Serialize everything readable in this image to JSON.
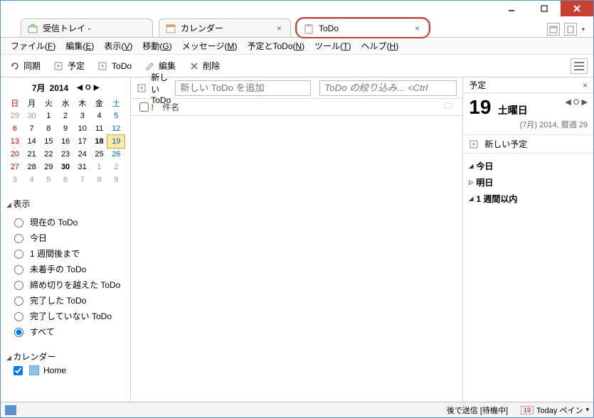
{
  "tabs": {
    "inbox": "受信トレイ -",
    "calendar": "カレンダー",
    "todo": "ToDo"
  },
  "menu": {
    "file": "ファイル(F)",
    "edit": "編集(E)",
    "view": "表示(V)",
    "go": "移動(G)",
    "message": "メッセージ(M)",
    "event_todo": "予定とToDo(N)",
    "tools": "ツール(T)",
    "help": "ヘルプ(H)"
  },
  "toolbar": {
    "sync": "同期",
    "event": "予定",
    "todo": "ToDo",
    "edit": "編集",
    "delete": "削除"
  },
  "calendar": {
    "month": "7月",
    "year": "2014",
    "dow": [
      "日",
      "月",
      "火",
      "水",
      "木",
      "金",
      "土"
    ],
    "rows": [
      [
        {
          "n": "29",
          "o": true
        },
        {
          "n": "30",
          "o": true
        },
        {
          "n": "1"
        },
        {
          "n": "2"
        },
        {
          "n": "3"
        },
        {
          "n": "4"
        },
        {
          "n": "5"
        }
      ],
      [
        {
          "n": "6"
        },
        {
          "n": "7"
        },
        {
          "n": "8"
        },
        {
          "n": "9"
        },
        {
          "n": "10"
        },
        {
          "n": "11"
        },
        {
          "n": "12"
        }
      ],
      [
        {
          "n": "13"
        },
        {
          "n": "14"
        },
        {
          "n": "15"
        },
        {
          "n": "16"
        },
        {
          "n": "17"
        },
        {
          "n": "18",
          "b": true
        },
        {
          "n": "19",
          "t": true
        }
      ],
      [
        {
          "n": "20"
        },
        {
          "n": "21"
        },
        {
          "n": "22"
        },
        {
          "n": "23"
        },
        {
          "n": "24"
        },
        {
          "n": "25"
        },
        {
          "n": "26"
        }
      ],
      [
        {
          "n": "27"
        },
        {
          "n": "28"
        },
        {
          "n": "29"
        },
        {
          "n": "30",
          "b": true
        },
        {
          "n": "31"
        },
        {
          "n": "1",
          "o": true
        },
        {
          "n": "2",
          "o": true
        }
      ],
      [
        {
          "n": "3",
          "o": true
        },
        {
          "n": "4",
          "o": true
        },
        {
          "n": "5",
          "o": true
        },
        {
          "n": "6",
          "o": true
        },
        {
          "n": "7",
          "o": true
        },
        {
          "n": "8",
          "o": true
        },
        {
          "n": "9",
          "o": true
        }
      ]
    ]
  },
  "filters": {
    "header": "表示",
    "items": [
      "現在の ToDo",
      "今日",
      "1 週間後まで",
      "未着手の ToDo",
      "締め切りを越えた ToDo",
      "完了した ToDo",
      "完了していない ToDo",
      "すべて"
    ],
    "selected": 7
  },
  "calsection": {
    "header": "カレンダー",
    "home": "Home"
  },
  "center": {
    "newtodo_label": "新しい ToDo",
    "newtodo_placeholder": "新しい ToDo を追加",
    "filter_placeholder": "ToDo の絞り込み... <Ctrl",
    "col_subject": "件名"
  },
  "right": {
    "header": "予定",
    "daynum": "19",
    "dow": "土曜日",
    "sub": "(7月) 2014, 暦週 29",
    "newevent": "新しい予定",
    "agenda": {
      "today": "今日",
      "tomorrow": "明日",
      "week": "1 週間以内"
    }
  },
  "status": {
    "send": "後で送信 [待機中]",
    "today": "Today ペイン",
    "daynum": "19"
  }
}
